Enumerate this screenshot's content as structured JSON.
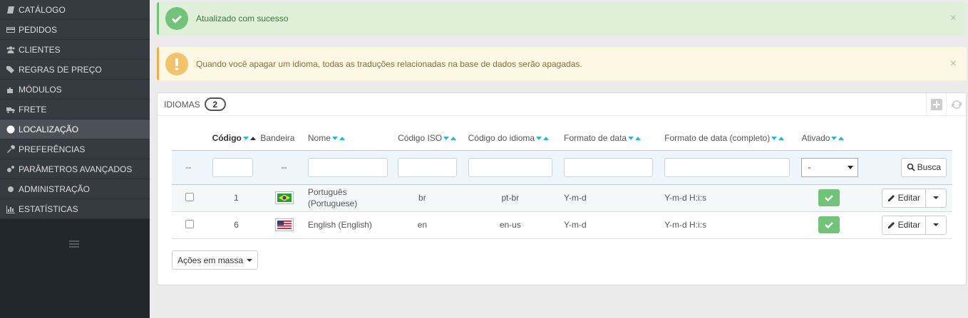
{
  "sidebar": {
    "items": [
      {
        "label": "CATÁLOGO",
        "icon": "book-icon"
      },
      {
        "label": "PEDIDOS",
        "icon": "credit-card-icon"
      },
      {
        "label": "CLIENTES",
        "icon": "users-icon"
      },
      {
        "label": "REGRAS DE PREÇO",
        "icon": "tags-icon"
      },
      {
        "label": "MÓDULOS",
        "icon": "puzzle-icon"
      },
      {
        "label": "FRETE",
        "icon": "truck-icon"
      },
      {
        "label": "LOCALIZAÇÃO",
        "icon": "globe-icon",
        "active": true
      },
      {
        "label": "PREFERÊNCIAS",
        "icon": "wrench-icon"
      },
      {
        "label": "PARÂMETROS AVANÇADOS",
        "icon": "cogs-icon"
      },
      {
        "label": "ADMINISTRAÇÃO",
        "icon": "cog-icon"
      },
      {
        "label": "ESTATÍSTICAS",
        "icon": "bar-chart-icon"
      }
    ]
  },
  "alerts": {
    "success": {
      "text": "Atualizado com sucesso",
      "close": "×"
    },
    "warning": {
      "text": "Quando você apagar um idioma, todas as traduções relacionadas na base de dados serão apagadas.",
      "close": "×"
    }
  },
  "panel": {
    "title": "IDIOMAS",
    "count": "2"
  },
  "table": {
    "headers": {
      "id": "Código",
      "flag": "Bandeira",
      "name": "Nome",
      "iso": "Código ISO",
      "lang_code": "Código do idioma",
      "date_format": "Formato de data",
      "date_format_full": "Formato de data (completo)",
      "active": "Ativado"
    },
    "filter": {
      "dash_id": "--",
      "dash_flag": "--",
      "active_select": "-",
      "search_button": "Busca"
    },
    "rows": [
      {
        "id": "1",
        "name": "Português (Portuguese)",
        "iso": "br",
        "lang_code": "pt-br",
        "date_format": "Y-m-d",
        "date_format_full": "Y-m-d H:i:s",
        "edit": "Editar",
        "flag": "brazil-flag-icon"
      },
      {
        "id": "6",
        "name": "English (English)",
        "iso": "en",
        "lang_code": "en-us",
        "date_format": "Y-m-d",
        "date_format_full": "Y-m-d H:i:s",
        "edit": "Editar",
        "flag": "usa-flag-icon"
      }
    ]
  },
  "bulk_actions_label": "Ações em massa",
  "colors": {
    "success": "#72c279",
    "warning": "#f0ad4e",
    "accent": "#25b9d7",
    "sidebar": "#363a41"
  }
}
